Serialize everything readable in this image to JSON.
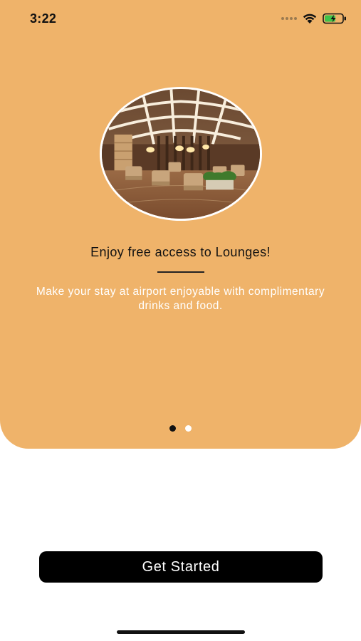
{
  "status_bar": {
    "time": "3:22"
  },
  "onboarding": {
    "image_alt": "Airport lounge interior",
    "title": "Enjoy free access to Lounges!",
    "subtitle": "Make your stay at airport enjoyable with complimentary drinks and food.",
    "page_count": 2,
    "current_page": 1
  },
  "actions": {
    "get_started_label": "Get Started"
  },
  "colors": {
    "hero_background": "#efb36a",
    "button_background": "#000000",
    "button_text": "#ffffff"
  },
  "icons": [
    "signal-dots-icon",
    "wifi-icon",
    "battery-charging-icon"
  ]
}
